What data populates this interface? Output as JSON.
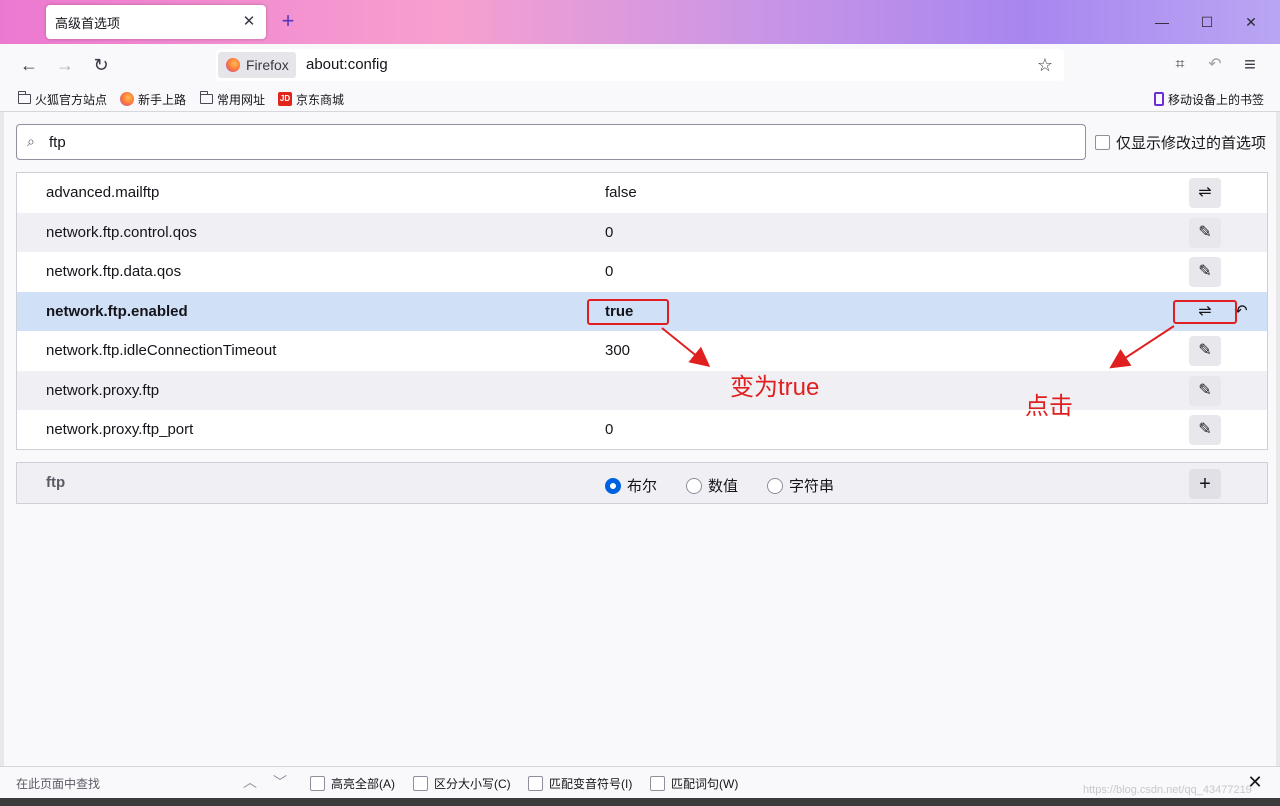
{
  "tab": {
    "title": "高级首选项",
    "close_glyph": "✕"
  },
  "window_controls": {
    "minimize": "—",
    "maximize": "☐",
    "close": "✕"
  },
  "nav": {
    "back": "←",
    "forward": "→",
    "reload": "↻",
    "identity_label": "Firefox",
    "url": "about:config",
    "bookmark_star": "☆",
    "screenshot_tool": "⌗",
    "undo_tool": "↶",
    "menu": "≡"
  },
  "bookmarks": {
    "items": [
      {
        "label": "火狐官方站点",
        "icon": "folder-icon"
      },
      {
        "label": "新手上路",
        "icon": "firefox-icon"
      },
      {
        "label": "常用网址",
        "icon": "folder-icon"
      },
      {
        "label": "京东商城",
        "icon": "jd-icon"
      }
    ],
    "jd_logo_text": "JD",
    "mobile_label": "移动设备上的书签"
  },
  "search": {
    "value": "ftp",
    "icon": "⌕"
  },
  "modified_only_label": "仅显示修改过的首选项",
  "prefs": [
    {
      "name": "advanced.mailftp",
      "value": "false",
      "action": "⇌",
      "action_icon": "toggle-icon"
    },
    {
      "name": "network.ftp.control.qos",
      "value": "0",
      "action": "✎",
      "action_icon": "edit-icon"
    },
    {
      "name": "network.ftp.data.qos",
      "value": "0",
      "action": "✎",
      "action_icon": "edit-icon"
    },
    {
      "name": "network.ftp.enabled",
      "value": "true",
      "action": "⇌",
      "action_icon": "toggle-icon",
      "reset": "↶"
    },
    {
      "name": "network.ftp.idleConnectionTimeout",
      "value": "300",
      "action": "✎",
      "action_icon": "edit-icon"
    },
    {
      "name": "network.proxy.ftp",
      "value": "",
      "action": "✎",
      "action_icon": "edit-icon"
    },
    {
      "name": "network.proxy.ftp_port",
      "value": "0",
      "action": "✎",
      "action_icon": "edit-icon"
    }
  ],
  "add_row": {
    "name": "ftp",
    "types": [
      {
        "label": "布尔",
        "selected": true
      },
      {
        "label": "数值",
        "selected": false
      },
      {
        "label": "字符串",
        "selected": false
      }
    ],
    "add_glyph": "+"
  },
  "annotations": {
    "value_note": "变为true",
    "click_note": "点击",
    "color": "#e02020"
  },
  "findbar": {
    "placeholder": "在此页面中查找",
    "up": "︿",
    "down": "﹀",
    "options": [
      "高亮全部(A)",
      "区分大小写(C)",
      "匹配变音符号(I)",
      "匹配词句(W)"
    ],
    "close": "✕"
  },
  "watermark": "https://blog.csdn.net/qq_43477219",
  "colors": {
    "accent": "#0061e0",
    "highlight_row": "#cfe0f7",
    "tab_plus": "#5a36b8"
  }
}
